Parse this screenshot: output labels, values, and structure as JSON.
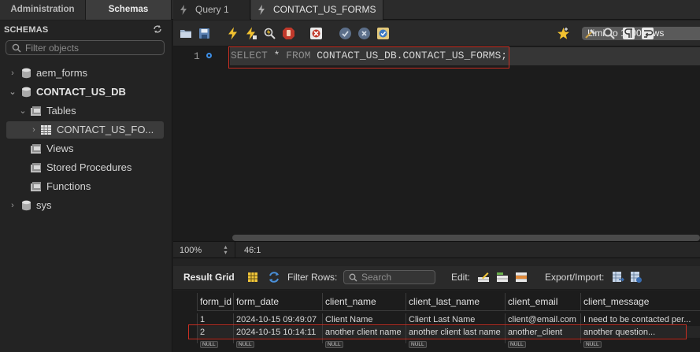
{
  "tabs": {
    "administration": "Administration",
    "schemas": "Schemas",
    "query_tabs": [
      {
        "label": "Query 1"
      },
      {
        "label": "CONTACT_US_FORMS"
      }
    ]
  },
  "sidebar": {
    "title": "SCHEMAS",
    "filter_placeholder": "Filter objects",
    "tree": [
      {
        "label": "aem_forms",
        "expanded": false
      },
      {
        "label": "CONTACT_US_DB",
        "expanded": true
      },
      {
        "label": "Tables",
        "expanded": true
      },
      {
        "label": "CONTACT_US_FO...",
        "expanded": false,
        "selected": true
      },
      {
        "label": "Views"
      },
      {
        "label": "Stored Procedures"
      },
      {
        "label": "Functions"
      },
      {
        "label": "sys",
        "expanded": false
      }
    ]
  },
  "toolbar": {
    "limit_label": "Limit to 1000 rows"
  },
  "editor": {
    "line_number": "1",
    "sql_select": "SELECT",
    "sql_star": " * ",
    "sql_from": "FROM",
    "sql_rest": " CONTACT_US_DB.CONTACT_US_FORMS;"
  },
  "status": {
    "zoom": "100%",
    "cursor": "46:1"
  },
  "results": {
    "result_grid": "Result Grid",
    "filter_rows": "Filter Rows:",
    "search_placeholder": "Search",
    "edit": "Edit:",
    "export_import": "Export/Import:",
    "columns": [
      "form_id",
      "form_date",
      "client_name",
      "client_last_name",
      "client_email",
      "client_message"
    ],
    "rows": [
      [
        "1",
        "2024-10-15 09:49:07",
        "Client Name",
        "Client Last Name",
        "client@email.com",
        "I need to be contacted per..."
      ],
      [
        "2",
        "2024-10-15 10:14:11",
        "another client name",
        "another client last name",
        "another_client",
        "another question..."
      ]
    ],
    "null_label": "NULL"
  },
  "colors": {
    "highlight": "#c72e22",
    "accent": "#2f7be0"
  }
}
